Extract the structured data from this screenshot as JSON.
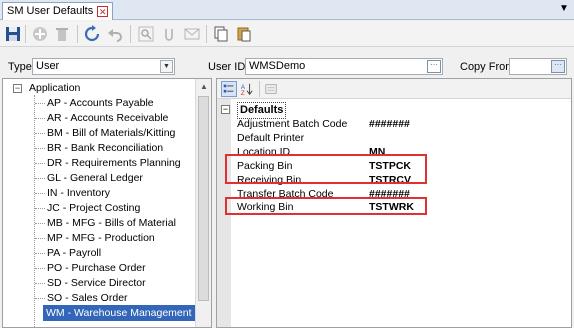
{
  "window": {
    "tab_title": "SM User Defaults",
    "close_icon": "close-icon"
  },
  "toolbar": {
    "buttons": [
      {
        "icon": "save-icon"
      },
      {
        "icon": "add-icon"
      },
      {
        "icon": "delete-icon"
      },
      {
        "icon": "refresh-icon"
      },
      {
        "icon": "undo-icon"
      },
      {
        "icon": "search-icon"
      },
      {
        "icon": "attach-icon"
      },
      {
        "icon": "email-icon"
      },
      {
        "icon": "copy-icon"
      },
      {
        "icon": "paste-icon"
      }
    ]
  },
  "form": {
    "type_label": "Type",
    "type_value": "User",
    "userid_label": "User ID",
    "userid_value": "WMSDemo",
    "copyfrom_label": "Copy From",
    "copyfrom_value": ""
  },
  "tree": {
    "root": "Application",
    "items": [
      "AP - Accounts Payable",
      "AR - Accounts Receivable",
      "BM - Bill of Materials/Kitting",
      "BR - Bank Reconciliation",
      "DR - Requirements Planning",
      "GL - General Ledger",
      "IN - Inventory",
      "JC - Project Costing",
      "MB - MFG - Bills of Material",
      "MP - MFG - Production",
      "PA - Payroll",
      "PO - Purchase Order",
      "SD - Service Director",
      "SO - Sales Order",
      "WM - Warehouse Management"
    ],
    "selected": "WM - Warehouse Management"
  },
  "property_grid": {
    "category": "Defaults",
    "rows": [
      {
        "name": "Adjustment Batch Code",
        "value": "#######"
      },
      {
        "name": "Default Printer",
        "value": ""
      },
      {
        "name": "Location ID",
        "value": "MN"
      },
      {
        "name": "Packing Bin",
        "value": "TSTPCK"
      },
      {
        "name": "Receiving Bin",
        "value": "TSTRCV"
      },
      {
        "name": "Transfer Batch Code",
        "value": "#######"
      },
      {
        "name": "Working Bin",
        "value": "TSTWRK"
      }
    ],
    "highlight_color": "#e03030"
  }
}
